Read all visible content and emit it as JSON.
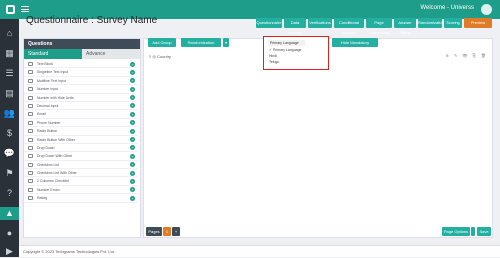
{
  "topbar": {
    "welcome": "Welcome - Universs"
  },
  "title": "Questionnaire : Survey Name",
  "header_buttons": [
    "Questionnaire",
    "Data Linkage",
    "Verifications",
    "Conditional Display",
    "Page Constraints",
    "Answer Piping",
    "Randomization",
    "Scoring",
    "Preview"
  ],
  "panel": {
    "title": "Questions",
    "tab_standard": "Standard",
    "tab_advance": "Advance"
  },
  "questions": [
    "Text Block",
    "Singleline Text Input",
    "Multiline Text Input",
    "Number Input",
    "Number with Hide Units",
    "Decimal Input",
    "Email",
    "Phone Number",
    "Radio Button",
    "Radio Button With Other",
    "Drop Down",
    "Drop Down With Other",
    "Checkbox List",
    "Checkbox List With Other",
    "2 Columns Checklist",
    "Number Enum",
    "Rating"
  ],
  "canvas": {
    "add_group": "Add Group",
    "randomization": "Randomization",
    "field_label": "Country",
    "hide_mandatory": "Hide Mandatory Validation",
    "pages_label": "Pages",
    "page_number": "1",
    "page_options": "Page Options",
    "save": "Save"
  },
  "language": {
    "selected": "Primary Language",
    "options": [
      "Primary Language",
      "Hindi",
      "Telugu"
    ]
  },
  "footer": "Copyright © 2023 Techgrams Technologies Pvt. Ltd.",
  "colors": {
    "accent": "#1e9e8a",
    "sidebar": "#2a3138",
    "highlight": "#d22222"
  }
}
